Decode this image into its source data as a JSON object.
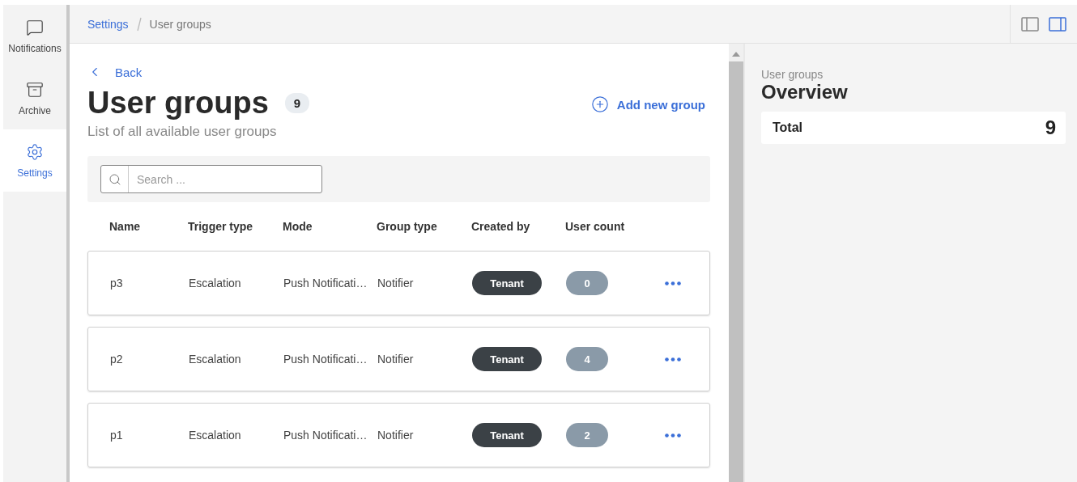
{
  "nav": [
    {
      "label": "Notifications",
      "kind": "chat",
      "selected": false
    },
    {
      "label": "Archive",
      "kind": "archive",
      "selected": false
    },
    {
      "label": "Settings",
      "kind": "gear",
      "selected": true
    }
  ],
  "breadcrumb": [
    "Settings",
    "User groups"
  ],
  "panel_toggles": [
    {
      "kind": "left",
      "selected": false
    },
    {
      "kind": "right",
      "selected": true
    }
  ],
  "back": "Back",
  "title": "User groups",
  "count": "9",
  "subtitle": "List of all available user groups",
  "add_button": "Add new group",
  "search": {
    "placeholder": "Search ..."
  },
  "table": {
    "columns": [
      "Name",
      "Trigger type",
      "Mode",
      "Group type",
      "Created by",
      "User count"
    ],
    "rows": [
      {
        "name": "p3",
        "trigger": "Escalation",
        "mode": "Push Notificati…",
        "group_type": "Notifier",
        "created_by": "Tenant",
        "user_count": "0"
      },
      {
        "name": "p2",
        "trigger": "Escalation",
        "mode": "Push Notificati…",
        "group_type": "Notifier",
        "created_by": "Tenant",
        "user_count": "4"
      },
      {
        "name": "p1",
        "trigger": "Escalation",
        "mode": "Push Notificati…",
        "group_type": "Notifier",
        "created_by": "Tenant",
        "user_count": "2"
      }
    ]
  },
  "overview": {
    "eyebrow": "User groups",
    "title": "Overview",
    "total_label": "Total",
    "total_value": "9"
  }
}
